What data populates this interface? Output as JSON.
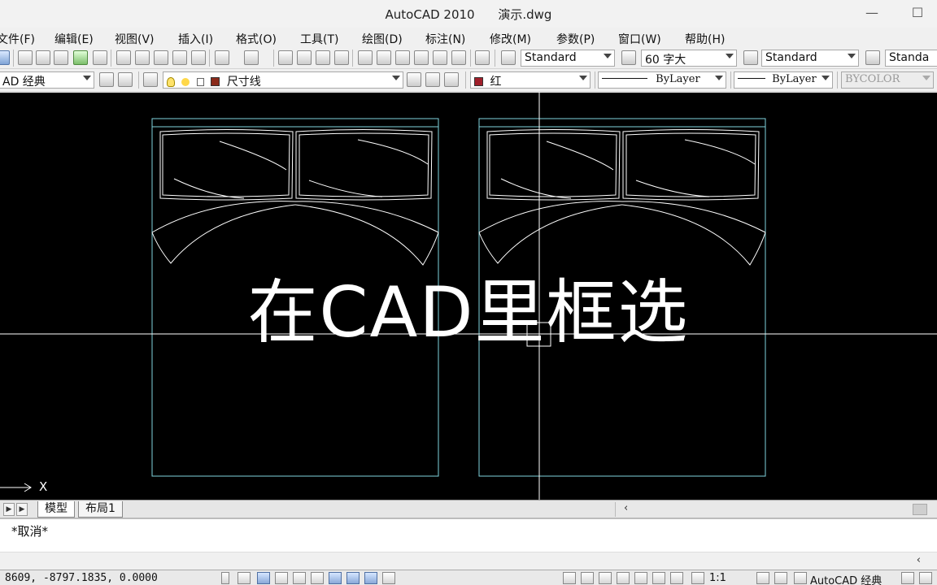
{
  "titlebar": {
    "app": "AutoCAD 2010",
    "file": "演示.dwg",
    "minimize_glyph": "—",
    "maximize_glyph": "☐"
  },
  "menu": [
    "文件(F)",
    "编辑(E)",
    "视图(V)",
    "插入(I)",
    "格式(O)",
    "工具(T)",
    "绘图(D)",
    "标注(N)",
    "修改(M)",
    "参数(P)",
    "窗口(W)",
    "帮助(H)"
  ],
  "toolbar1": {
    "text_style": "Standard",
    "dim_style": "60 字大",
    "table_style": "Standard",
    "multileader_style": "Standa"
  },
  "toolbar2": {
    "workspace": "AD 经典",
    "layer": "尺寸线",
    "color": "红",
    "linetype": "ByLayer",
    "lineweight": "ByLayer",
    "plotstyle": "BYCOLOR"
  },
  "canvas": {
    "overlay_caption": "在CAD里框选",
    "ucs_x_label": "X",
    "background": "#000000",
    "frame_color": "#7fd3de",
    "line_color": "#ffffff"
  },
  "tabs": {
    "model": "模型",
    "layout1": "布局1"
  },
  "command": {
    "history": "*取消*"
  },
  "status": {
    "coordinates": "8609,  -8797.1835,  0.0000",
    "scale": "1:1",
    "workspace": "AutoCAD 经典"
  }
}
